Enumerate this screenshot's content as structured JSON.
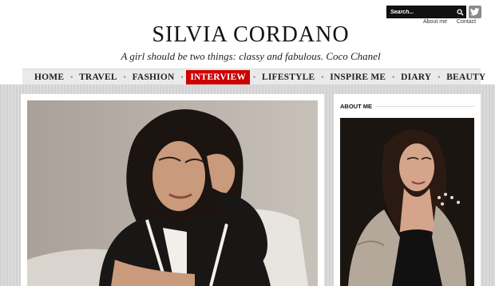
{
  "search": {
    "placeholder": "Search..."
  },
  "top_links": [
    "About me",
    "Contact"
  ],
  "site": {
    "title": "SILVIA CORDANO",
    "tagline": "A girl should be two things: classy and fabulous. Coco Chanel"
  },
  "nav": {
    "items": [
      {
        "label": "HOME"
      },
      {
        "label": "TRAVEL"
      },
      {
        "label": "FASHION"
      },
      {
        "label": "INTERVIEW",
        "active": true
      },
      {
        "label": "LIFESTYLE"
      },
      {
        "label": "INSPIRE ME"
      },
      {
        "label": "DIARY"
      },
      {
        "label": "BEAUTY"
      }
    ],
    "separator": "▪"
  },
  "sidebar": {
    "about_title": "ABOUT ME"
  },
  "icons": {
    "search": "search-icon",
    "twitter": "twitter-icon"
  },
  "colors": {
    "accent": "#cc0000",
    "nav_bg": "#eaeaea"
  }
}
